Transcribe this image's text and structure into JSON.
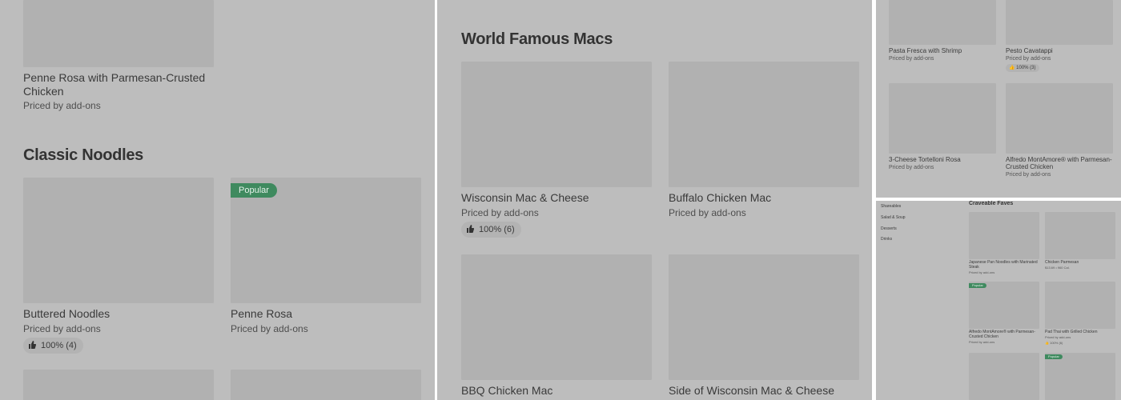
{
  "panel1": {
    "item_top": {
      "title": "Penne Rosa with Parmesan-Crusted Chicken",
      "price": "Priced by add-ons"
    },
    "section_heading": "Classic Noodles",
    "items": [
      {
        "title": "Buttered Noodles",
        "price": "Priced by add-ons",
        "rating": "100% (4)"
      },
      {
        "title": "Penne Rosa",
        "price": "Priced by add-ons",
        "badge": "Popular"
      }
    ]
  },
  "panel2": {
    "section_heading": "World Famous Macs",
    "items": [
      {
        "title": "Wisconsin Mac & Cheese",
        "price": "Priced by add-ons",
        "rating": "100% (6)"
      },
      {
        "title": "Buffalo Chicken Mac",
        "price": "Priced by add-ons"
      },
      {
        "title": "BBQ Chicken Mac"
      },
      {
        "title": "Side of Wisconsin Mac & Cheese"
      }
    ]
  },
  "panel3": {
    "items": [
      {
        "title": "Pasta Fresca with Shrimp",
        "price": "Priced by add-ons"
      },
      {
        "title": "Pesto Cavatappi",
        "price": "Priced by add-ons",
        "rating": "100% (3)"
      },
      {
        "title": "3-Cheese Tortelloni Rosa",
        "price": "Priced by add-ons"
      },
      {
        "title": "Alfredo MontAmore® with Parmesan-Crusted Chicken",
        "price": "Priced by add-ons"
      }
    ]
  },
  "panel4": {
    "sidebar": [
      "Shareables",
      "Salad & Soup",
      "Desserts",
      "Drinks"
    ],
    "section_heading": "Craveable Faves",
    "items": [
      {
        "title": "Japanese Pan Noodles with Marinated Steak",
        "price": "Priced by add-ons"
      },
      {
        "title": "Chicken Parmesan",
        "price": "$13.69 • 960 Cal."
      },
      {
        "title": "Alfredo MontAmore® with Parmesan-Crusted Chicken",
        "price": "Priced by add-ons",
        "badge": "Popular"
      },
      {
        "title": "Pad Thai with Grilled Chicken",
        "price": "Priced by add-ons",
        "rating": "100% (6)"
      }
    ],
    "bottom_badge": "Popular"
  },
  "colors": {
    "overlay": "#bdbdbd",
    "image": "#b1b1b1",
    "badge": "#3f8a5f"
  }
}
